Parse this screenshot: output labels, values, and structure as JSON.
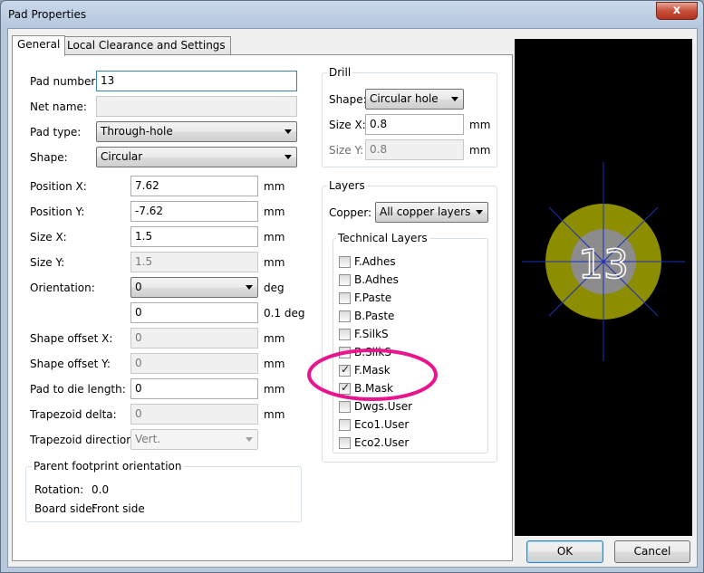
{
  "window": {
    "title": "Pad Properties",
    "close_label": "x"
  },
  "tabs": [
    {
      "label": "General"
    },
    {
      "label": "Local Clearance and Settings"
    }
  ],
  "general": {
    "pad_number": {
      "label": "Pad number:",
      "value": "13"
    },
    "net_name": {
      "label": "Net name:",
      "value": ""
    },
    "pad_type": {
      "label": "Pad type:",
      "value": "Through-hole"
    },
    "shape": {
      "label": "Shape:",
      "value": "Circular"
    },
    "position_x": {
      "label": "Position X:",
      "value": "7.62",
      "unit": "mm"
    },
    "position_y": {
      "label": "Position Y:",
      "value": "-7.62",
      "unit": "mm"
    },
    "size_x": {
      "label": "Size X:",
      "value": "1.5",
      "unit": "mm"
    },
    "size_y": {
      "label": "Size Y:",
      "value": "1.5",
      "unit": "mm"
    },
    "orientation": {
      "label": "Orientation:",
      "value": "0",
      "unit": "deg"
    },
    "orientation_fine": {
      "value": "0",
      "unit": "0.1 deg"
    },
    "shape_offset_x": {
      "label": "Shape offset X:",
      "value": "0",
      "unit": "mm"
    },
    "shape_offset_y": {
      "label": "Shape offset Y:",
      "value": "0",
      "unit": "mm"
    },
    "pad_to_die": {
      "label": "Pad to die length:",
      "value": "0",
      "unit": "mm"
    },
    "trapezoid_delta": {
      "label": "Trapezoid delta:",
      "value": "0",
      "unit": "mm"
    },
    "trapezoid_direction": {
      "label": "Trapezoid direction:",
      "value": "Vert."
    }
  },
  "parent_footprint": {
    "title": "Parent footprint orientation",
    "rotation_label": "Rotation:",
    "rotation_value": "0.0",
    "board_side_label": "Board side:",
    "board_side_value": "Front side"
  },
  "drill": {
    "title": "Drill",
    "shape_label": "Shape:",
    "shape_value": "Circular hole",
    "size_x_label": "Size X:",
    "size_x_value": "0.8",
    "size_x_unit": "mm",
    "size_y_label": "Size Y:",
    "size_y_value": "0.8",
    "size_y_unit": "mm"
  },
  "layers": {
    "title": "Layers",
    "copper_label": "Copper:",
    "copper_value": "All copper layers",
    "technical_title": "Technical Layers",
    "technical": [
      {
        "label": "F.Adhes",
        "checked": false
      },
      {
        "label": "B.Adhes",
        "checked": false
      },
      {
        "label": "F.Paste",
        "checked": false
      },
      {
        "label": "B.Paste",
        "checked": false
      },
      {
        "label": "F.SilkS",
        "checked": false
      },
      {
        "label": "B.SilkS",
        "checked": false
      },
      {
        "label": "F.Mask",
        "checked": true
      },
      {
        "label": "B.Mask",
        "checked": true
      },
      {
        "label": "Dwgs.User",
        "checked": false
      },
      {
        "label": "Eco1.User",
        "checked": false
      },
      {
        "label": "Eco2.User",
        "checked": false
      }
    ]
  },
  "preview": {
    "pad_label": "13",
    "pad_color": "#8d8d00",
    "hole_color": "#8c8c8c",
    "crosshair_color": "#1c2fb8"
  },
  "annotation": {
    "circle_color": "#e8158f"
  },
  "buttons": {
    "ok": "OK",
    "cancel": "Cancel"
  }
}
